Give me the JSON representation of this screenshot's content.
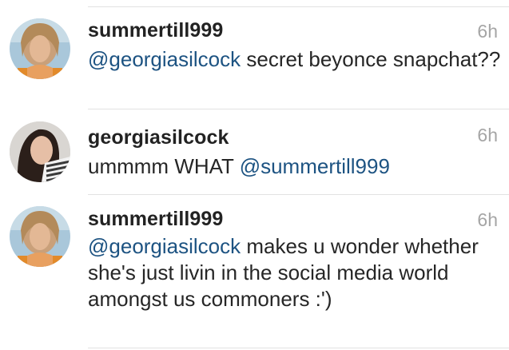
{
  "colors": {
    "mention": "#1d5382",
    "username": "#222222",
    "timestamp": "#a5a5a5",
    "divider": "#e2e2e2"
  },
  "comments": [
    {
      "username": "summertill999",
      "time": "6h",
      "mention": "@georgiasilcock",
      "text": " secret beyonce snapchat??"
    },
    {
      "username": "georgiasilcock",
      "time": "6h",
      "text": "ummmm WHAT ",
      "mention": "@summertill999"
    },
    {
      "username": "summertill999",
      "time": "6h",
      "mention": "@georgiasilcock",
      "text": " makes u wonder whether she's just livin in the social media world amongst us commoners :')"
    }
  ]
}
